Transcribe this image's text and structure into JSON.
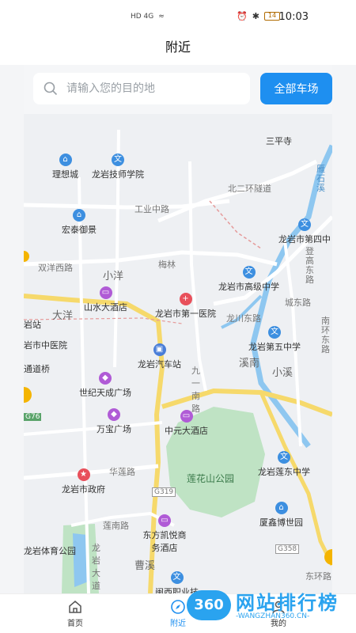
{
  "status_bar": {
    "time": "10:03",
    "battery": "14",
    "left_icons": "HD 4G"
  },
  "header": {
    "title": "附近"
  },
  "search": {
    "placeholder": "请输入您的目的地",
    "all_lots_label": "全部车场"
  },
  "map": {
    "pois": [
      {
        "name": "三平寺"
      },
      {
        "name": "理想城"
      },
      {
        "name": "龙岩技师学院"
      },
      {
        "name": "宏泰御景"
      },
      {
        "name": "龙岩市第四中"
      },
      {
        "name": "龙岩市高级中学"
      },
      {
        "name": "山水大酒店"
      },
      {
        "name": "龙岩市第一医院"
      },
      {
        "name": "岩市中医院"
      },
      {
        "name": "龙岩第五中学"
      },
      {
        "name": "龙岩汽车站"
      },
      {
        "name": "世纪天成广场"
      },
      {
        "name": "万宝广场"
      },
      {
        "name": "中元大酒店"
      },
      {
        "name": "龙岩市政府"
      },
      {
        "name": "龙岩莲东中学"
      },
      {
        "name": "厦鑫博世园"
      },
      {
        "name": "东方凯悦商务酒店"
      },
      {
        "name": "龙岩体育公园"
      },
      {
        "name": "闽西职业技"
      }
    ],
    "areas": [
      "小洋",
      "大洋",
      "溪南",
      "小溪",
      "曹溪",
      "梅林"
    ],
    "roads": [
      "北二环隧道",
      "工业中路",
      "双洋西路",
      "龙川东路",
      "城东路",
      "九一南路",
      "华莲路",
      "莲南路",
      "龙岩大道",
      "莲花山公园",
      "登高东路",
      "南环东路",
      "东环路",
      "G319",
      "G358",
      "G76",
      "雁石溪",
      "通道桥",
      "岩站"
    ]
  },
  "tabbar": {
    "home": "首页",
    "nearby": "附近",
    "mine": "我的"
  },
  "watermark": {
    "logo": "360",
    "title": "网站排行榜",
    "sub": "-WANGZHAN360.CN-"
  },
  "colors": {
    "accent": "#1e8ff0",
    "park": "#bfe3c4",
    "water": "#8ec7f0",
    "main_road": "#f6d96b"
  }
}
